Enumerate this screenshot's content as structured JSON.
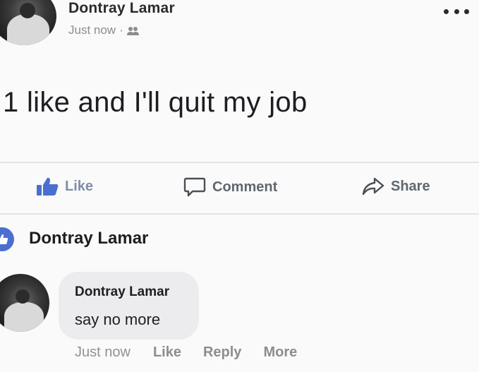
{
  "post": {
    "author": "Dontray Lamar",
    "timestamp": "Just now",
    "separator": "·",
    "audience_icon": "friends-icon",
    "text": "1 like and I'll quit my job"
  },
  "actions": {
    "like": "Like",
    "comment": "Comment",
    "share": "Share"
  },
  "reaction": {
    "name": "Dontray Lamar",
    "icon": "like-badge-icon"
  },
  "comment": {
    "author": "Dontray Lamar",
    "text": "say no more",
    "timestamp": "Just now",
    "like": "Like",
    "reply": "Reply",
    "more": "More"
  },
  "colors": {
    "like_blue": "#4a6fd1",
    "muted_text": "#8a8d91",
    "bubble_bg": "#ececee"
  }
}
